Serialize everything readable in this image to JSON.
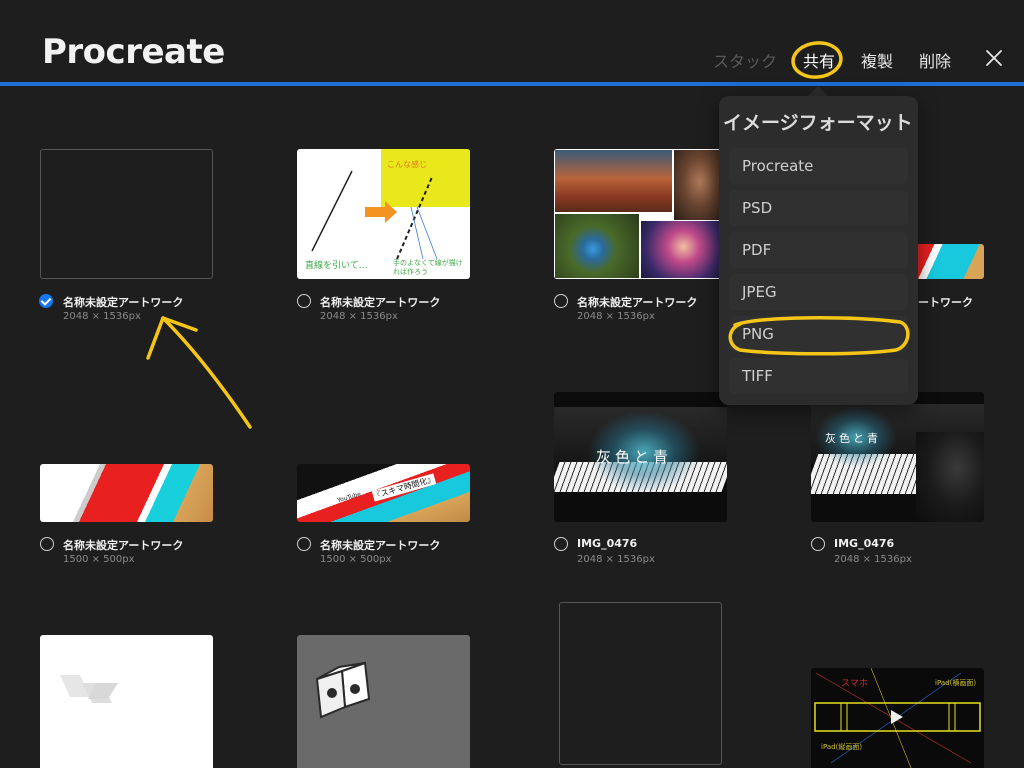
{
  "header": {
    "title": "Procreate",
    "stack_label": "スタック",
    "share_label": "共有",
    "duplicate_label": "複製",
    "delete_label": "削除"
  },
  "colors": {
    "accent": "#1e6ed8",
    "check": "#1677f0",
    "annotation": "#f5c518"
  },
  "artworks": [
    {
      "name": "名称未設定アートワーク",
      "dims": "2048 × 1536px",
      "selected": true
    },
    {
      "name": "名称未設定アートワーク",
      "dims": "2048 × 1536px",
      "selected": false
    },
    {
      "name": "名称未設定アートワーク",
      "dims": "2048 × 1536px",
      "selected": false
    },
    {
      "name": "ートワーク",
      "dims": "",
      "selected": false
    },
    {
      "name": "名称未設定アートワーク",
      "dims": "1500 × 500px",
      "selected": false
    },
    {
      "name": "名称未設定アートワーク",
      "dims": "1500 × 500px",
      "selected": false
    },
    {
      "name": "IMG_0476",
      "dims": "2048 × 1536px",
      "selected": false
    },
    {
      "name": "IMG_0476",
      "dims": "2048 × 1536px",
      "selected": false
    }
  ],
  "thumb_text": {
    "sketch_left": "直線を引いて…",
    "sketch_box": "こんな感じ",
    "sketch_right": "手のよなくて線が描ければ作ろう",
    "banner_main": "『スキマ時間化』",
    "banner_sub": "YouTube",
    "piano_title": "灰色と青",
    "piano_title2": "灰色と青",
    "dark_top": "スマホ",
    "dark_right": "iPad(横画面)",
    "dark_bottom": "iPad(縦画面)"
  },
  "share_menu": {
    "title": "イメージフォーマット",
    "formats": [
      "Procreate",
      "PSD",
      "PDF",
      "JPEG",
      "PNG",
      "TIFF"
    ],
    "highlighted": "PNG"
  }
}
